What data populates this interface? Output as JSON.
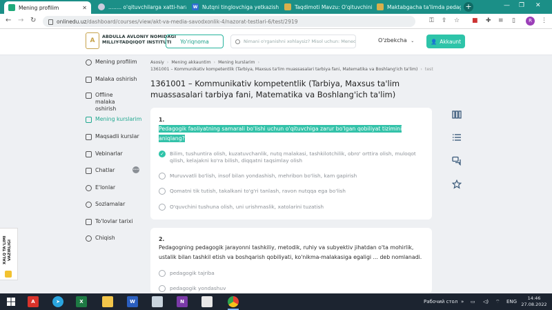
{
  "browser": {
    "tabs": [
      {
        "title": "Mening profilim",
        "active": true
      },
      {
        "title": "........ o'qituvchilarga xatti-harak"
      },
      {
        "title": "Nutqni tinglovchiga yetkazish"
      },
      {
        "title": "Taqdimoti Mavzu: O'qituvchini"
      },
      {
        "title": "Maktabgacha ta'limda pedago"
      }
    ],
    "new_tab": "+",
    "url_host": "onlinedu.uz",
    "url_path": "/dashboard/courses/view/akt-va-media-savodxonlik-4/nazorat-testlari-6/test/2919",
    "profile_letter": "R"
  },
  "header": {
    "logo_line1": "ABDULLA AVLONIY NOMIDAGI",
    "logo_line2": "MILLIY-TADQIQOT INSTITUTI",
    "guide_button": "Yo'riqnoma",
    "search_placeholder": "Nimani o'rganishni xohlaysiz? Misol uchun: Menedjme",
    "language": "O'zbekcha",
    "account_button": "Akkaunt"
  },
  "sidebar": {
    "items": [
      {
        "label": "Mening profilim"
      },
      {
        "label": "Malaka oshirish"
      },
      {
        "label": "Offline malaka oshirish"
      },
      {
        "label": "Mening kurslarim",
        "active": true
      },
      {
        "label": "Maqsadli kurslar"
      },
      {
        "label": "Vebinarlar"
      },
      {
        "label": "Chatlar"
      },
      {
        "label": "E'lonlar"
      },
      {
        "label": "Sozlamalar"
      },
      {
        "label": "To'lovlar tarixi"
      },
      {
        "label": "Chiqish"
      }
    ]
  },
  "breadcrumb": {
    "items": [
      "Asosiy",
      "Mening akkauntim",
      "Mening kurslarim"
    ],
    "course": "1361001 – Kommunikativ kompetentlik (Tarbiya, Maxsus ta'lim muassasalari tarbiya fani, Matematika va Boshlang'ich ta'lim)",
    "current": "test"
  },
  "page_title": "1361001 – Kommunikativ kompetentlik (Tarbiya, Maxsus ta'lim muassasalari tarbiya fani, Matematika va Boshlang'ich ta'lim)",
  "questions": [
    {
      "number": "1.",
      "text": "Pedagogik faoliyatning samarali bo'lishi uchun o'qituvchiga zarur bo'lgan qobiliyat tizimini aniqlang?",
      "options": [
        {
          "text": "Bilim, tushuntira olish, kuzatuvchanlik, nutq malakasi, tashkilotchilik, obro' orttira olish, muloqot qilish, kelajakni ko'ra bilish, diqqatni taqsimlay olish",
          "selected": true
        },
        {
          "text": "Muruvvatli bo'lish, insof bilan yondashish, mehribon bo'lish, kam gapirish"
        },
        {
          "text": "Qomatni tik tutish, takalkani to'g'ri tanlash, ravon nutqqa ega bo'lish"
        },
        {
          "text": "O'quvchini tushuna olish, uni urishmaslik, xatolarini tuzatish"
        }
      ]
    },
    {
      "number": "2.",
      "text": "Pedagogning pedagogik jarayonni tashkiliy, metodik, ruhiy va subyektiv jihatdan o'ta mohirlik, ustalik bilan tashkil etish va boshqarish qobiliyati, ko'nikma-malakasiga egaligi ... deb nomlanadi.",
      "options": [
        {
          "text": "pedagogik tajriba"
        },
        {
          "text": "pedagogik yondashuv"
        }
      ]
    }
  ],
  "promo": {
    "text": "XALQ TA'LIMI VAZIRLIGI"
  },
  "taskbar": {
    "desktop_label": "Рабочий стол",
    "lang": "ENG",
    "time": "14:46",
    "date": "27.08.2022"
  }
}
